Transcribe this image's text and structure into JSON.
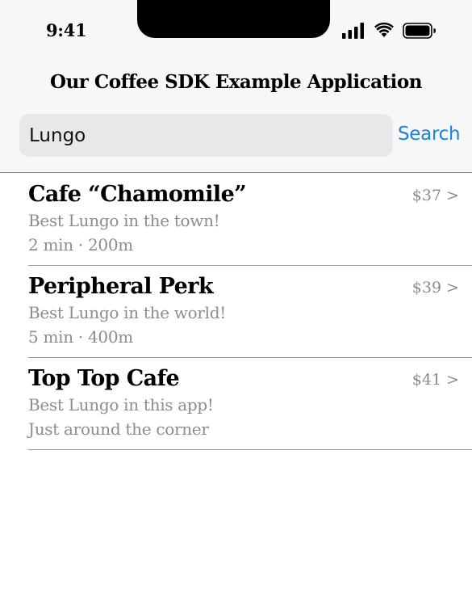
{
  "status_bar": {
    "time": "9:41",
    "icons": [
      "cellular-signal-icon",
      "wifi-icon",
      "battery-icon"
    ]
  },
  "app": {
    "title": "Our Coffee SDK Example Application"
  },
  "search": {
    "value": "Lungo",
    "button_label": "Search"
  },
  "colors": {
    "accent": "#1a82e2",
    "secondary_text": "#8c8c8c",
    "header_background": "#f7f7f7",
    "search_field_background": "#e8e8ea"
  },
  "results": [
    {
      "name": "Cafe “Chamomile”",
      "price": "$37 >",
      "description": "Best Lungo in the town!",
      "meta": "2 min · 200m"
    },
    {
      "name": "Peripheral Perk",
      "price": "$39 >",
      "description": "Best Lungo in the world!",
      "meta": "5 min · 400m"
    },
    {
      "name": "Top Top Cafe",
      "price": "$41 >",
      "description": "Best Lungo in this app!",
      "meta": "Just around the corner"
    }
  ]
}
